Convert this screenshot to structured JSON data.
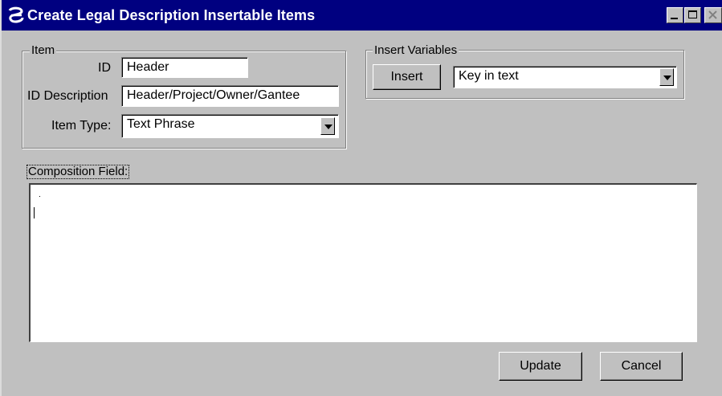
{
  "window": {
    "title": "Create Legal Description Insertable Items",
    "controls": [
      "minimize-icon",
      "maximize-icon",
      "close-icon"
    ]
  },
  "item_group": {
    "legend": "Item",
    "id_label": "ID",
    "id_value": "Header",
    "desc_label": "ID Description",
    "desc_value": "Header/Project/Owner/Gantee",
    "type_label": "Item Type:",
    "type_value": "Text Phrase"
  },
  "insert_group": {
    "legend": "Insert Variables",
    "insert_button": "Insert",
    "variable_value": "Key in text"
  },
  "composition": {
    "label": "Composition Field:",
    "text": ""
  },
  "buttons": {
    "update": "Update",
    "cancel": "Cancel"
  },
  "colors": {
    "titlebar": "#000080",
    "face": "#c0c0c0"
  }
}
